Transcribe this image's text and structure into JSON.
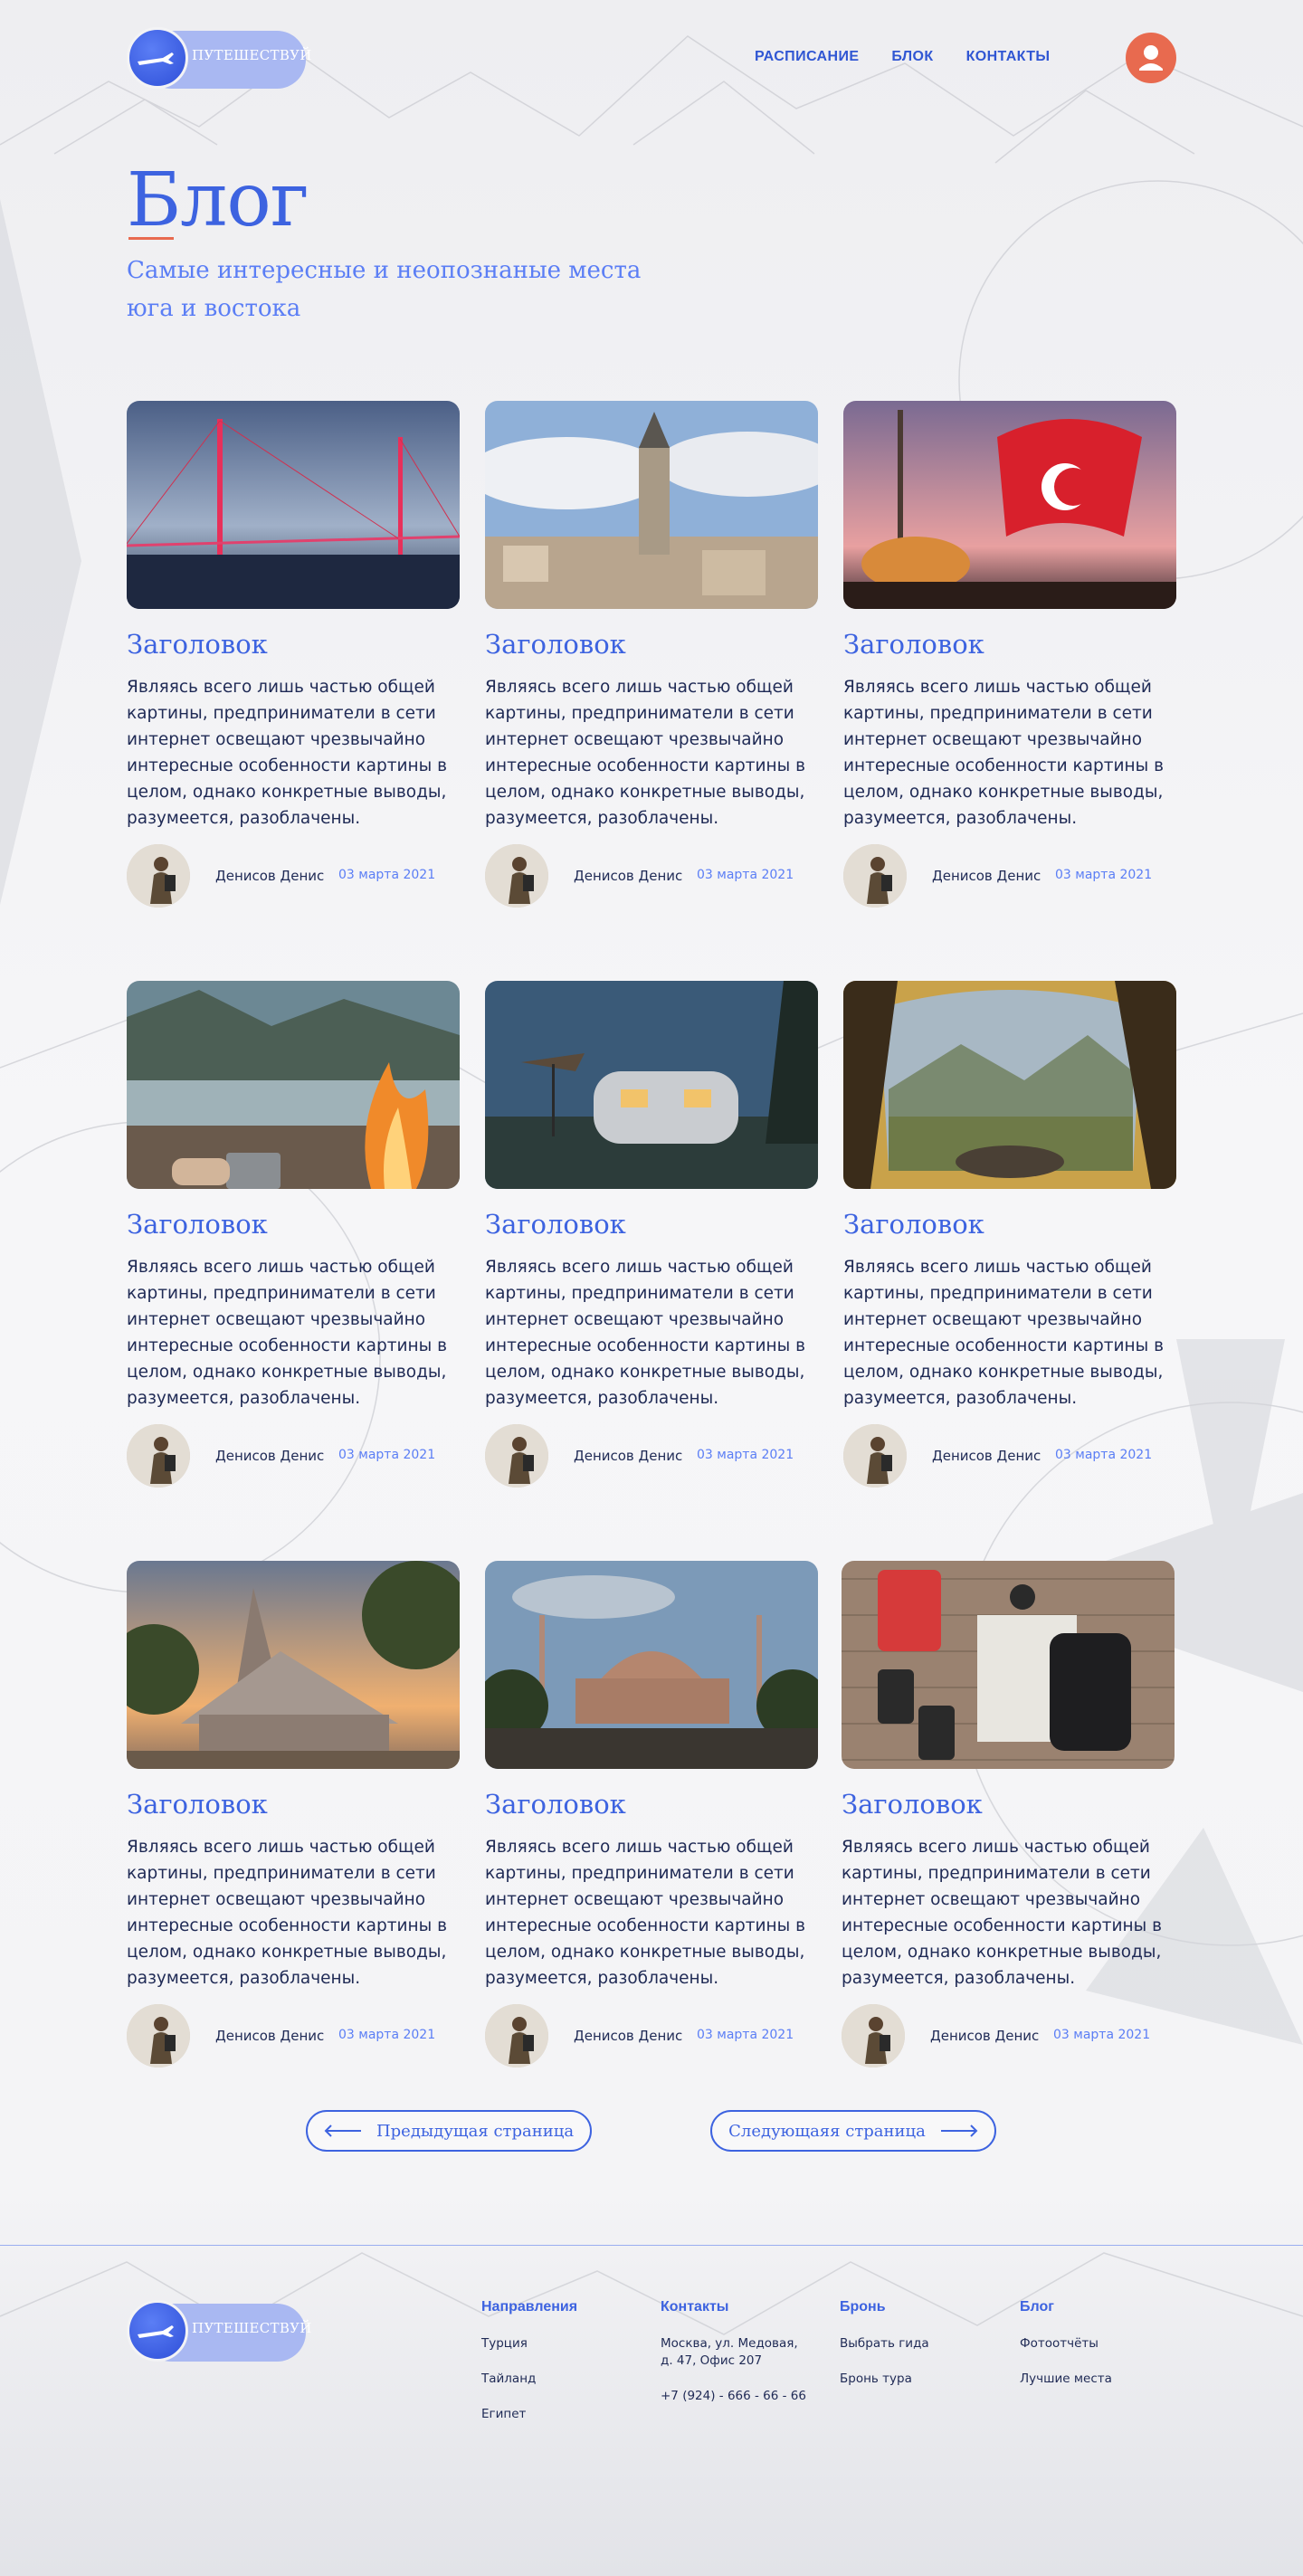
{
  "header": {
    "logo_text": "ПУТЕШЕСТВУЙ",
    "nav": [
      "РАСПИСАНИЕ",
      "БЛОК",
      "КОНТАКТЫ"
    ]
  },
  "hero": {
    "title": "Блог",
    "subtitle": "Самые интересные и неопознаные места юга и востока"
  },
  "posts": [
    {
      "title": "Заголовок",
      "text": "Являясь всего лишь частью общей картины, предприниматели в сети интернет освещают чрезвычайно интересные особенности картины в целом, однако конкретные выводы, разумеется, разоблачены.",
      "author": "Денисов Денис",
      "date": "03 марта 2021",
      "image": "bridge-night"
    },
    {
      "title": "Заголовок",
      "text": "Являясь всего лишь частью общей картины, предприниматели в сети интернет освещают чрезвычайно интересные особенности картины в целом, однако конкретные выводы, разумеется, разоблачены.",
      "author": "Денисов Денис",
      "date": "03 марта 2021",
      "image": "galata-tower"
    },
    {
      "title": "Заголовок",
      "text": "Являясь всего лишь частью общей картины, предприниматели в сети интернет освещают чрезвычайно интересные особенности картины в целом, однако конкретные выводы, разумеется, разоблачены.",
      "author": "Денисов Денис",
      "date": "03 марта 2021",
      "image": "turkey-flag-mosque"
    },
    {
      "title": "Заголовок",
      "text": "Являясь всего лишь частью общей картины, предприниматели в сети интернет освещают чрезвычайно интересные особенности картины в целом, однако конкретные выводы, разумеется, разоблачены.",
      "author": "Денисов Денис",
      "date": "03 марта 2021",
      "image": "campfire-lake"
    },
    {
      "title": "Заголовок",
      "text": "Являясь всего лишь частью общей картины, предприниматели в сети интернет освещают чрезвычайно интересные особенности картины в целом, однако конкретные выводы, разумеется, разоблачены.",
      "author": "Денисов Денис",
      "date": "03 марта 2021",
      "image": "camper-trailer"
    },
    {
      "title": "Заголовок",
      "text": "Являясь всего лишь частью общей картины, предприниматели в сети интернет освещают чрезвычайно интересные особенности картины в целом, однако конкретные выводы, разумеется, разоблачены.",
      "author": "Денисов Денис",
      "date": "03 марта 2021",
      "image": "tent-mountains"
    },
    {
      "title": "Заголовок",
      "text": "Являясь всего лишь частью общей картины, предприниматели в сети интернет освещают чрезвычайно интересные особенности картины в целом, однако конкретные выводы, разумеется, разоблачены.",
      "author": "Денисов Денис",
      "date": "03 марта 2021",
      "image": "thai-temple"
    },
    {
      "title": "Заголовок",
      "text": "Являясь всего лишь частью общей картины, предприниматели в сети интернет освещают чрезвычайно интересные особенности картины в целом, однако конкретные выводы, разумеется, разоблачены.",
      "author": "Денисов Денис",
      "date": "03 марта 2021",
      "image": "hagia-sophia"
    },
    {
      "title": "Заголовок",
      "text": "Являясь всего лишь частью общей картины, предприниматели в сети интернет освещают чрезвычайно интересные особенности картины в целом, однако конкретные выводы, разумеется, разоблачены.",
      "author": "Денисов Денис",
      "date": "03 марта 2021",
      "image": "travel-gear"
    }
  ],
  "pagination": {
    "prev": "Предыдущая страница",
    "next": "Следующаяя страница"
  },
  "footer": {
    "columns": [
      {
        "title": "Направления",
        "items": [
          "Турция",
          "Тайланд",
          "Египет"
        ]
      },
      {
        "title": "Контакты",
        "items": [
          "Москва, ул. Медовая,\nд. 47, Офис 207",
          "+7 (924) - 666 - 66 - 66"
        ]
      },
      {
        "title": "Бронь",
        "items": [
          "Выбрать гида",
          "Бронь тура"
        ]
      },
      {
        "title": "Блог",
        "items": [
          "Фотоотчёты",
          "Лучшие места"
        ]
      }
    ]
  },
  "colors": {
    "accent": "#3d63e0",
    "accent_light": "#5b7ef5",
    "avatar": "#e86a4f",
    "text": "#1f2a55"
  }
}
